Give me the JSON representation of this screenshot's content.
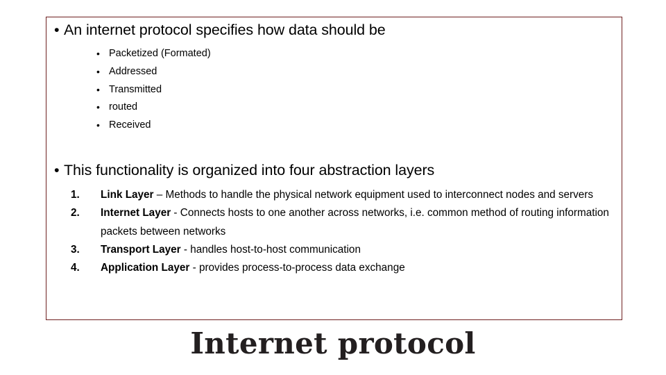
{
  "slide": {
    "title": "Internet protocol",
    "border_color": "#6E1F1F",
    "background": "#ffffff",
    "title_color": "#231F20"
  },
  "bullet_char": "•",
  "bullets": [
    {
      "id": "main-1",
      "text": "An internet protocol specifies how data should be"
    },
    {
      "id": "main-2",
      "text": "This functionality is organized into four abstraction layers"
    }
  ],
  "sub_bullets": [
    {
      "text": "Packetized (Formated)"
    },
    {
      "text": "Addressed"
    },
    {
      "text": "Transmitted"
    },
    {
      "text": "routed"
    },
    {
      "text": "Received"
    }
  ],
  "numbered_list": [
    {
      "number": "1.",
      "lead": "Link Layer",
      "rest": " – Methods to handle the physical network equipment used to interconnect nodes and servers"
    },
    {
      "number": "2.",
      "lead": "Internet Layer",
      "rest": " - Connects hosts to one another across networks, i.e. common method of routing information packets between networks"
    },
    {
      "number": "3.",
      "lead": "Transport Layer",
      "rest": " - handles host-to-host communication"
    },
    {
      "number": "4.",
      "lead": "Application Layer",
      "rest": " - provides process-to-process data exchange"
    }
  ]
}
